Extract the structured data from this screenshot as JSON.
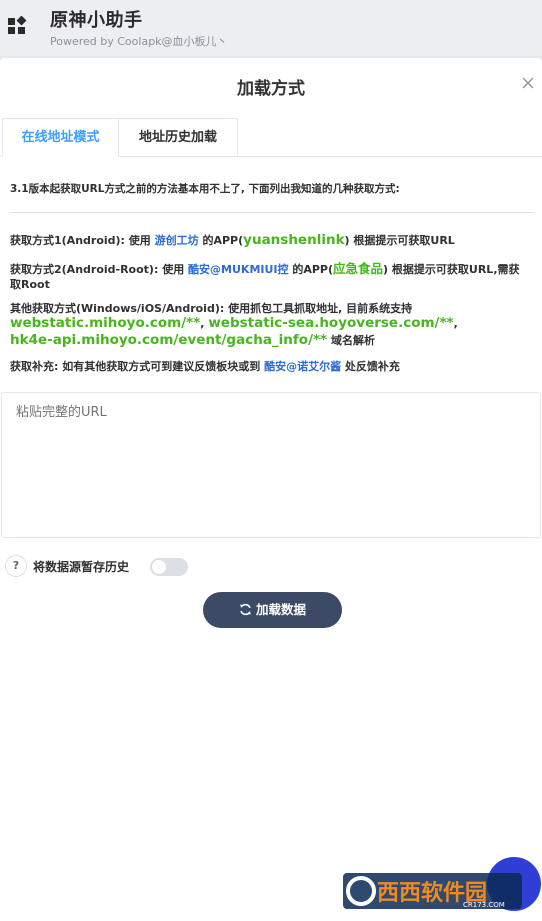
{
  "app": {
    "title": "原神小助手",
    "subtitle": "Powered by Coolapk@血小板儿丶"
  },
  "modal": {
    "title": "加载方式",
    "tabs": [
      {
        "label": "在线地址模式",
        "active": true
      },
      {
        "label": "地址历史加载",
        "active": false
      }
    ],
    "notice": "3.1版本起获取URL方式之前的方法基本用不上了, 下面列出我知道的几种获取方式:",
    "method1": {
      "prefix": "获取方式1(Android): 使用",
      "link": "游创工坊",
      "mid": "的APP(",
      "app": "yuanshenlink",
      "suffix": ") 根据提示可获取URL"
    },
    "method2": {
      "prefix": "获取方式2(Android-Root): 使用",
      "link": "酷安@MUKMIUI控",
      "mid": "的APP(",
      "app": "应急食品",
      "suffix": ") 根据提示可获取URL,需获",
      "suffix2": "取Root"
    },
    "other": {
      "prefix": "其他获取方式(Windows/iOS/Android): 使用抓包工具抓取地址, 目前系统支持",
      "domain1": "webstatic.mihoyo.com/**",
      "sep": ",",
      "domain2": "webstatic-sea.hoyoverse.com/**",
      "domain3": "hk4e-api.mihoyo.com/event/gacha_info/**",
      "suffix": "域名解析"
    },
    "supplement": {
      "prefix": "获取补充: 如有其他获取方式可到建议反馈板块或到",
      "link": "酷安@诺艾尔酱",
      "suffix": "处反馈补充"
    },
    "url_placeholder": "粘贴完整的URL",
    "help_label": "?",
    "save_history_label": "将数据源暂存历史",
    "save_history_enabled": false,
    "load_button_label": "加载数据"
  },
  "watermark": {
    "text": "西西软件园",
    "sub": "CR173.COM"
  },
  "colors": {
    "accent": "#409eff",
    "link": "#2d6bd4",
    "green": "#49b51e",
    "button": "#3d4a66",
    "fab": "#2f3fd6"
  }
}
